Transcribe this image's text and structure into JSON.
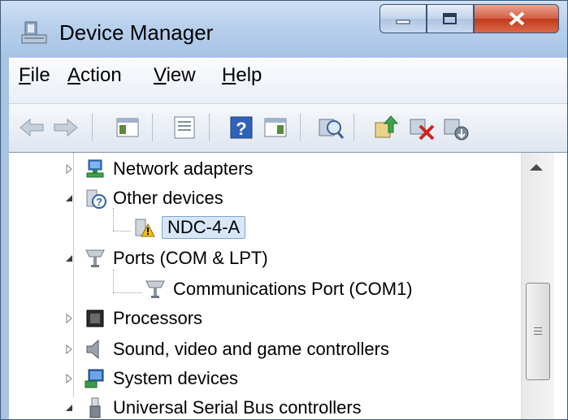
{
  "window": {
    "title": "Device Manager",
    "caption_buttons": [
      "minimize",
      "maximize",
      "close"
    ]
  },
  "menu": [
    {
      "label": "File",
      "mnemonic": "F",
      "rest": "ile"
    },
    {
      "label": "Action",
      "mnemonic": "A",
      "rest": "ction"
    },
    {
      "label": "View",
      "mnemonic": "V",
      "rest": "iew"
    },
    {
      "label": "Help",
      "mnemonic": "H",
      "rest": "elp"
    }
  ],
  "toolbar": {
    "buttons": [
      "back-arrow-icon",
      "forward-arrow-icon",
      "show-hide-console-tree-icon",
      "properties-icon",
      "help-icon",
      "action-pane-icon",
      "scan-hardware-changes-icon",
      "update-driver-icon",
      "uninstall-device-icon",
      "disable-device-icon"
    ]
  },
  "tree": [
    {
      "label": "Network adapters",
      "icon": "network-adapter-icon",
      "expanded": false,
      "level": 1
    },
    {
      "label": "Other devices",
      "icon": "unknown-device-icon",
      "expanded": true,
      "level": 1
    },
    {
      "label": "NDC-4-A",
      "icon": "warning-device-icon",
      "level": 2,
      "selected": true
    },
    {
      "label": "Ports (COM & LPT)",
      "icon": "port-icon",
      "expanded": true,
      "level": 1
    },
    {
      "label": "Communications Port (COM1)",
      "icon": "port-icon",
      "level": 2
    },
    {
      "label": "Processors",
      "icon": "processor-icon",
      "expanded": false,
      "level": 1
    },
    {
      "label": "Sound, video and game controllers",
      "icon": "speaker-icon",
      "expanded": false,
      "level": 1
    },
    {
      "label": "System devices",
      "icon": "system-device-icon",
      "expanded": false,
      "level": 1
    },
    {
      "label": "Universal Serial Bus controllers",
      "icon": "usb-icon",
      "expanded": true,
      "level": 1
    }
  ]
}
